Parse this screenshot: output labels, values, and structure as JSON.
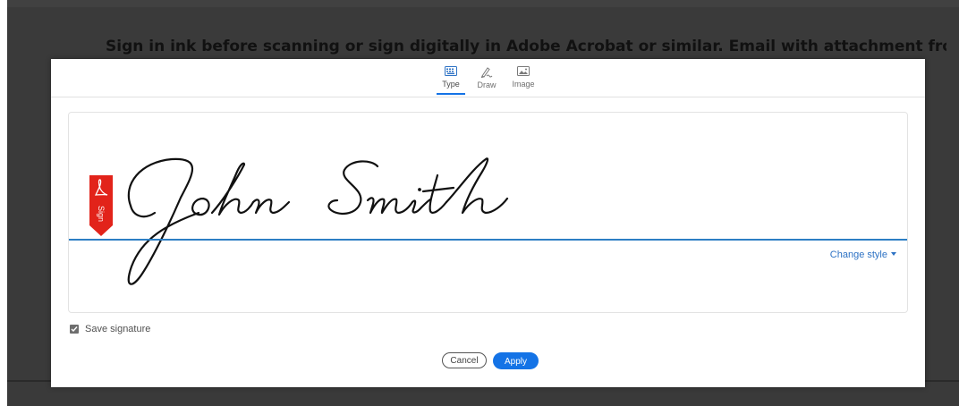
{
  "document": {
    "heading": "Sign in ink before scanning or sign digitally in Adobe Acrobat or similar. Email with attachment from your"
  },
  "dialog": {
    "tabs": [
      {
        "label": "Type",
        "icon": "keyboard-icon",
        "active": true
      },
      {
        "label": "Draw",
        "icon": "pen-icon",
        "active": false
      },
      {
        "label": "Image",
        "icon": "image-icon",
        "active": false
      }
    ],
    "signature_text": "John Smith",
    "sign_flag_label": "Sign",
    "change_style_label": "Change style",
    "save_signature_label": "Save signature",
    "save_signature_checked": true,
    "cancel_label": "Cancel",
    "apply_label": "Apply"
  },
  "colors": {
    "accent": "#1473e6",
    "baseline": "#2d7fc4",
    "sign_flag": "#e2231a",
    "backdrop": "#414141"
  }
}
